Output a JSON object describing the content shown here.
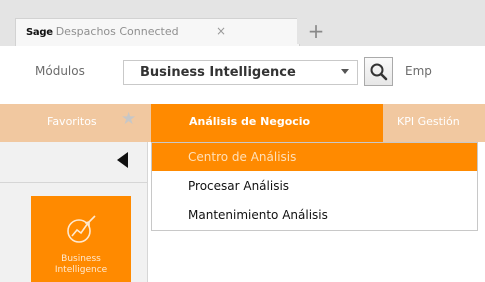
{
  "tab": {
    "brand": "Sage",
    "title": "Despachos Connected",
    "close": "×",
    "new_tab": "+"
  },
  "module_bar": {
    "label": "Módulos",
    "selected_module": "Business Intelligence",
    "next_label": "Emp"
  },
  "main_nav": {
    "favoritos": "Favoritos",
    "star": "★",
    "active_tab": "Análisis de Negocio",
    "kpi": "KPI Gestión"
  },
  "dropdown": {
    "items": [
      {
        "label": "Centro de Análisis"
      },
      {
        "label": "Procesar Análisis"
      },
      {
        "label": "Mantenimiento Análisis"
      }
    ]
  },
  "sidebar": {
    "tile_line1": "Business",
    "tile_line2": "Intelligence"
  },
  "colors": {
    "accent": "#ff8a00",
    "nav_bar": "#f1c8a0"
  }
}
